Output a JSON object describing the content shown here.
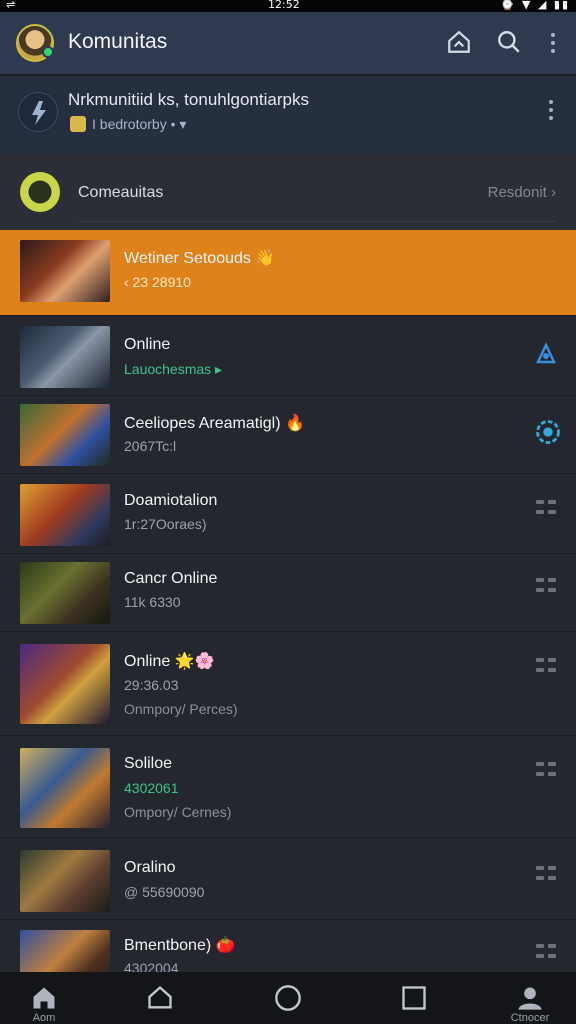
{
  "status_bar": {
    "time": "12:52",
    "left": "⇌",
    "right_icons": "⌚ ▼ ◢ ▮▮"
  },
  "app_bar": {
    "title": "Komunitas"
  },
  "community": {
    "name": "Nrkmunitiid ks, tonuhlgontiarpks",
    "sub": "I bedrotorby • ▾"
  },
  "section": {
    "label": "Comeauitas",
    "right": "Resdonit ›"
  },
  "items": [
    {
      "title": "Wetiner Setoouds 👋",
      "line2": "‹ 23 28910",
      "line3": "",
      "highlight": true
    },
    {
      "title": "Online",
      "line2": "Lauochesmas ▸",
      "line3": "",
      "line2_color": "#3ec28a"
    },
    {
      "title": "Ceeliopes Areamatigl) 🔥",
      "line2": "2067Tc:l",
      "line3": ""
    },
    {
      "title": "Doamiotalion",
      "line2": "1r:27Ooraes)",
      "line3": ""
    },
    {
      "title": "Cancr Online",
      "line2": "11k 6330",
      "line3": ""
    },
    {
      "title": "Online 🌟🌸",
      "line2": "29:36.03",
      "line3": "Onmpory/ Perces)"
    },
    {
      "title": "Soliloe",
      "line2": "4302061",
      "line3": "Ompory/ Cernes)",
      "line2_color": "#3ec28a"
    },
    {
      "title": "Oralino",
      "line2": "@ 55690090",
      "line3": ""
    },
    {
      "title": "Bmentbone) 🍅",
      "line2": "4302004",
      "line3": ""
    }
  ],
  "nav": [
    {
      "label": "Aom"
    },
    {
      "label": ""
    },
    {
      "label": ""
    },
    {
      "label": ""
    },
    {
      "label": "Ctnocer"
    }
  ],
  "colors": {
    "highlight": "#e0821c",
    "accent_blue": "#3a8fdc"
  }
}
